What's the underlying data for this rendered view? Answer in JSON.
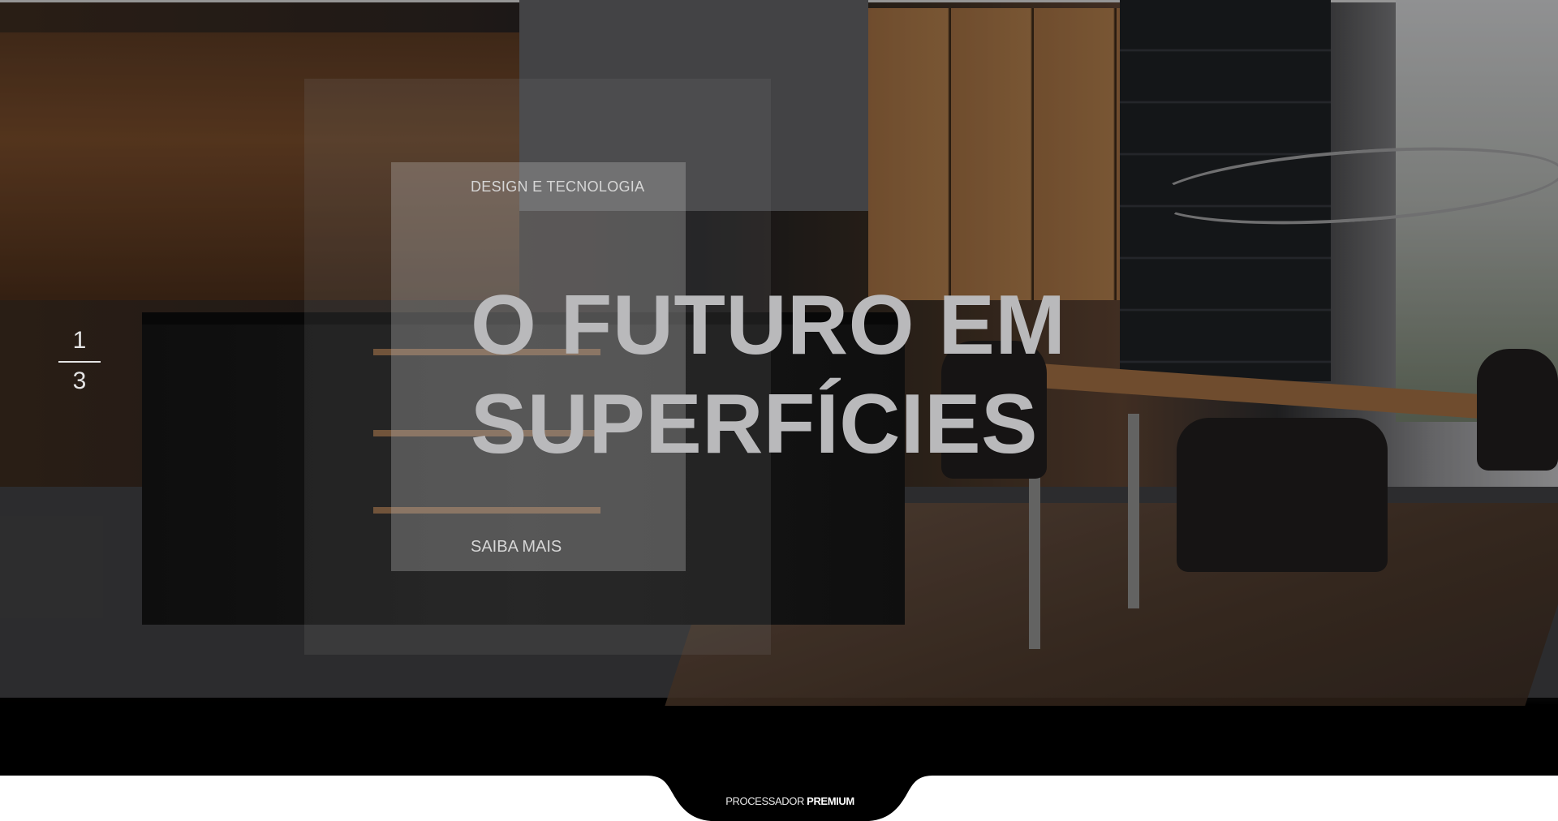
{
  "hero": {
    "subtitle": "DESIGN E TECNOLOGIA",
    "headline_line1": "O FUTURO EM",
    "headline_line2": "SUPERFÍCIES",
    "cta_label": "SAIBA MAIS"
  },
  "slider": {
    "current": "1",
    "total": "3"
  },
  "footer": {
    "brand_light": "PROCESSADOR",
    "brand_bold": "PREMIUM"
  },
  "colors": {
    "headline": "#b9b9bb",
    "footer_tab": "#000000",
    "page_background": "#ffffff"
  }
}
